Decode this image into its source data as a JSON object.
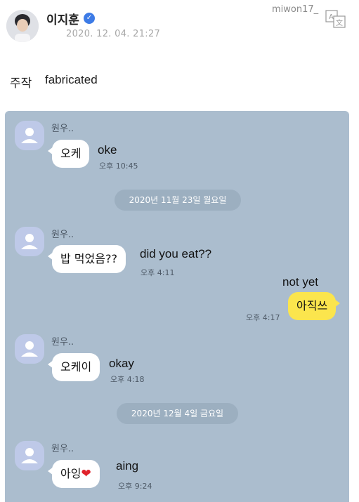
{
  "header": {
    "author": "이지훈",
    "date": "2020. 12. 04. 21:27",
    "uploader": "miwon17_"
  },
  "note": {
    "label": "주작",
    "text": "fabricated"
  },
  "chat": {
    "sender": "원우..",
    "messages": [
      {
        "text": "오케",
        "time": "오후 10:45",
        "translation": "oke"
      },
      {
        "divider": "2020년 11월 23일 월요일"
      },
      {
        "text": "밥 먹었음??",
        "time": "오후 4:11",
        "translation": "did you eat??"
      },
      {
        "text": "아직쓰",
        "time": "오후 4:17",
        "translation": "not yet",
        "mine": true
      },
      {
        "text": "오케이",
        "time": "오후 4:18",
        "translation": "okay"
      },
      {
        "divider": "2020년 12월 4일 금요일"
      },
      {
        "text": "아잉",
        "emoji": "❤",
        "time": "오후 9:24",
        "translation": "aing"
      }
    ]
  },
  "colors": {
    "chat_bg": "#abbdce",
    "my_bubble": "#fbe54d",
    "verified": "#3d7be6"
  }
}
